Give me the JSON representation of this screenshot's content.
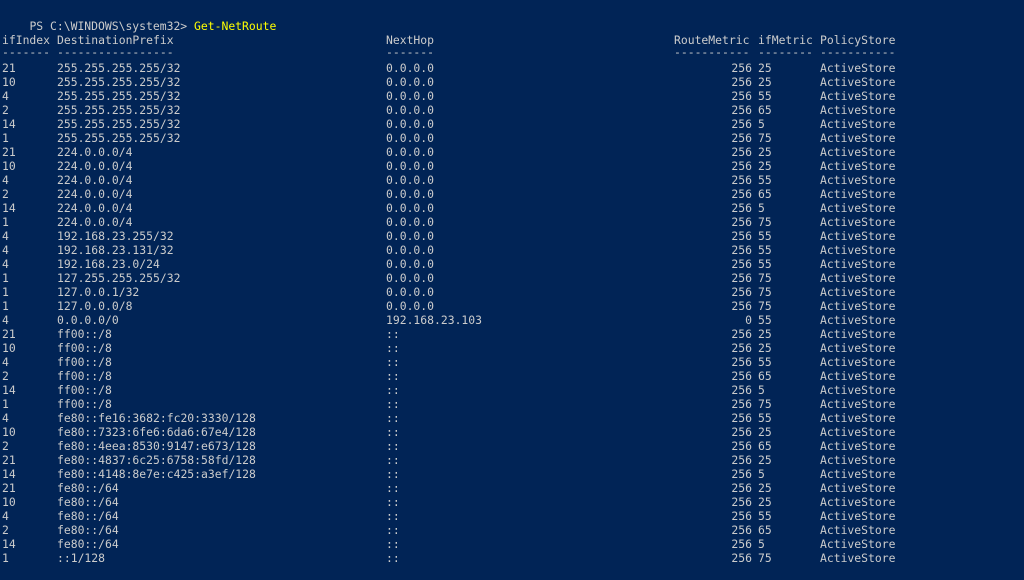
{
  "prompt": {
    "path": "PS C:\\WINDOWS\\system32>",
    "command": "Get-NetRoute"
  },
  "table": {
    "headers": {
      "ifIndex": "ifIndex",
      "DestinationPrefix": "DestinationPrefix",
      "NextHop": "NextHop",
      "RouteMetric": "RouteMetric",
      "ifMetric": "ifMetric",
      "PolicyStore": "PolicyStore"
    },
    "underlines": {
      "ifIndex": "-------",
      "DestinationPrefix": "-----------------",
      "NextHop": "-------",
      "RouteMetric": "-----------",
      "ifMetric": "--------",
      "PolicyStore": "-----------"
    },
    "rows": [
      {
        "ifIndex": "21",
        "dest": "255.255.255.255/32",
        "nexthop": "0.0.0.0",
        "routemetric": "256",
        "ifmetric": "25",
        "policy": "ActiveStore"
      },
      {
        "ifIndex": "10",
        "dest": "255.255.255.255/32",
        "nexthop": "0.0.0.0",
        "routemetric": "256",
        "ifmetric": "25",
        "policy": "ActiveStore"
      },
      {
        "ifIndex": "4",
        "dest": "255.255.255.255/32",
        "nexthop": "0.0.0.0",
        "routemetric": "256",
        "ifmetric": "55",
        "policy": "ActiveStore"
      },
      {
        "ifIndex": "2",
        "dest": "255.255.255.255/32",
        "nexthop": "0.0.0.0",
        "routemetric": "256",
        "ifmetric": "65",
        "policy": "ActiveStore"
      },
      {
        "ifIndex": "14",
        "dest": "255.255.255.255/32",
        "nexthop": "0.0.0.0",
        "routemetric": "256",
        "ifmetric": "5",
        "policy": "ActiveStore"
      },
      {
        "ifIndex": "1",
        "dest": "255.255.255.255/32",
        "nexthop": "0.0.0.0",
        "routemetric": "256",
        "ifmetric": "75",
        "policy": "ActiveStore"
      },
      {
        "ifIndex": "21",
        "dest": "224.0.0.0/4",
        "nexthop": "0.0.0.0",
        "routemetric": "256",
        "ifmetric": "25",
        "policy": "ActiveStore"
      },
      {
        "ifIndex": "10",
        "dest": "224.0.0.0/4",
        "nexthop": "0.0.0.0",
        "routemetric": "256",
        "ifmetric": "25",
        "policy": "ActiveStore"
      },
      {
        "ifIndex": "4",
        "dest": "224.0.0.0/4",
        "nexthop": "0.0.0.0",
        "routemetric": "256",
        "ifmetric": "55",
        "policy": "ActiveStore"
      },
      {
        "ifIndex": "2",
        "dest": "224.0.0.0/4",
        "nexthop": "0.0.0.0",
        "routemetric": "256",
        "ifmetric": "65",
        "policy": "ActiveStore"
      },
      {
        "ifIndex": "14",
        "dest": "224.0.0.0/4",
        "nexthop": "0.0.0.0",
        "routemetric": "256",
        "ifmetric": "5",
        "policy": "ActiveStore"
      },
      {
        "ifIndex": "1",
        "dest": "224.0.0.0/4",
        "nexthop": "0.0.0.0",
        "routemetric": "256",
        "ifmetric": "75",
        "policy": "ActiveStore"
      },
      {
        "ifIndex": "4",
        "dest": "192.168.23.255/32",
        "nexthop": "0.0.0.0",
        "routemetric": "256",
        "ifmetric": "55",
        "policy": "ActiveStore"
      },
      {
        "ifIndex": "4",
        "dest": "192.168.23.131/32",
        "nexthop": "0.0.0.0",
        "routemetric": "256",
        "ifmetric": "55",
        "policy": "ActiveStore"
      },
      {
        "ifIndex": "4",
        "dest": "192.168.23.0/24",
        "nexthop": "0.0.0.0",
        "routemetric": "256",
        "ifmetric": "55",
        "policy": "ActiveStore"
      },
      {
        "ifIndex": "1",
        "dest": "127.255.255.255/32",
        "nexthop": "0.0.0.0",
        "routemetric": "256",
        "ifmetric": "75",
        "policy": "ActiveStore"
      },
      {
        "ifIndex": "1",
        "dest": "127.0.0.1/32",
        "nexthop": "0.0.0.0",
        "routemetric": "256",
        "ifmetric": "75",
        "policy": "ActiveStore"
      },
      {
        "ifIndex": "1",
        "dest": "127.0.0.0/8",
        "nexthop": "0.0.0.0",
        "routemetric": "256",
        "ifmetric": "75",
        "policy": "ActiveStore"
      },
      {
        "ifIndex": "4",
        "dest": "0.0.0.0/0",
        "nexthop": "192.168.23.103",
        "routemetric": "0",
        "ifmetric": "55",
        "policy": "ActiveStore"
      },
      {
        "ifIndex": "21",
        "dest": "ff00::/8",
        "nexthop": "::",
        "routemetric": "256",
        "ifmetric": "25",
        "policy": "ActiveStore"
      },
      {
        "ifIndex": "10",
        "dest": "ff00::/8",
        "nexthop": "::",
        "routemetric": "256",
        "ifmetric": "25",
        "policy": "ActiveStore"
      },
      {
        "ifIndex": "4",
        "dest": "ff00::/8",
        "nexthop": "::",
        "routemetric": "256",
        "ifmetric": "55",
        "policy": "ActiveStore"
      },
      {
        "ifIndex": "2",
        "dest": "ff00::/8",
        "nexthop": "::",
        "routemetric": "256",
        "ifmetric": "65",
        "policy": "ActiveStore"
      },
      {
        "ifIndex": "14",
        "dest": "ff00::/8",
        "nexthop": "::",
        "routemetric": "256",
        "ifmetric": "5",
        "policy": "ActiveStore"
      },
      {
        "ifIndex": "1",
        "dest": "ff00::/8",
        "nexthop": "::",
        "routemetric": "256",
        "ifmetric": "75",
        "policy": "ActiveStore"
      },
      {
        "ifIndex": "4",
        "dest": "fe80::fe16:3682:fc20:3330/128",
        "nexthop": "::",
        "routemetric": "256",
        "ifmetric": "55",
        "policy": "ActiveStore"
      },
      {
        "ifIndex": "10",
        "dest": "fe80::7323:6fe6:6da6:67e4/128",
        "nexthop": "::",
        "routemetric": "256",
        "ifmetric": "25",
        "policy": "ActiveStore"
      },
      {
        "ifIndex": "2",
        "dest": "fe80::4eea:8530:9147:e673/128",
        "nexthop": "::",
        "routemetric": "256",
        "ifmetric": "65",
        "policy": "ActiveStore"
      },
      {
        "ifIndex": "21",
        "dest": "fe80::4837:6c25:6758:58fd/128",
        "nexthop": "::",
        "routemetric": "256",
        "ifmetric": "25",
        "policy": "ActiveStore"
      },
      {
        "ifIndex": "14",
        "dest": "fe80::4148:8e7e:c425:a3ef/128",
        "nexthop": "::",
        "routemetric": "256",
        "ifmetric": "5",
        "policy": "ActiveStore"
      },
      {
        "ifIndex": "21",
        "dest": "fe80::/64",
        "nexthop": "::",
        "routemetric": "256",
        "ifmetric": "25",
        "policy": "ActiveStore"
      },
      {
        "ifIndex": "10",
        "dest": "fe80::/64",
        "nexthop": "::",
        "routemetric": "256",
        "ifmetric": "25",
        "policy": "ActiveStore"
      },
      {
        "ifIndex": "4",
        "dest": "fe80::/64",
        "nexthop": "::",
        "routemetric": "256",
        "ifmetric": "55",
        "policy": "ActiveStore"
      },
      {
        "ifIndex": "2",
        "dest": "fe80::/64",
        "nexthop": "::",
        "routemetric": "256",
        "ifmetric": "65",
        "policy": "ActiveStore"
      },
      {
        "ifIndex": "14",
        "dest": "fe80::/64",
        "nexthop": "::",
        "routemetric": "256",
        "ifmetric": "5",
        "policy": "ActiveStore"
      },
      {
        "ifIndex": "1",
        "dest": "::1/128",
        "nexthop": "::",
        "routemetric": "256",
        "ifmetric": "75",
        "policy": "ActiveStore"
      }
    ]
  },
  "colors": {
    "background": "#012456",
    "text": "#cccccc",
    "command": "#ffff00"
  }
}
